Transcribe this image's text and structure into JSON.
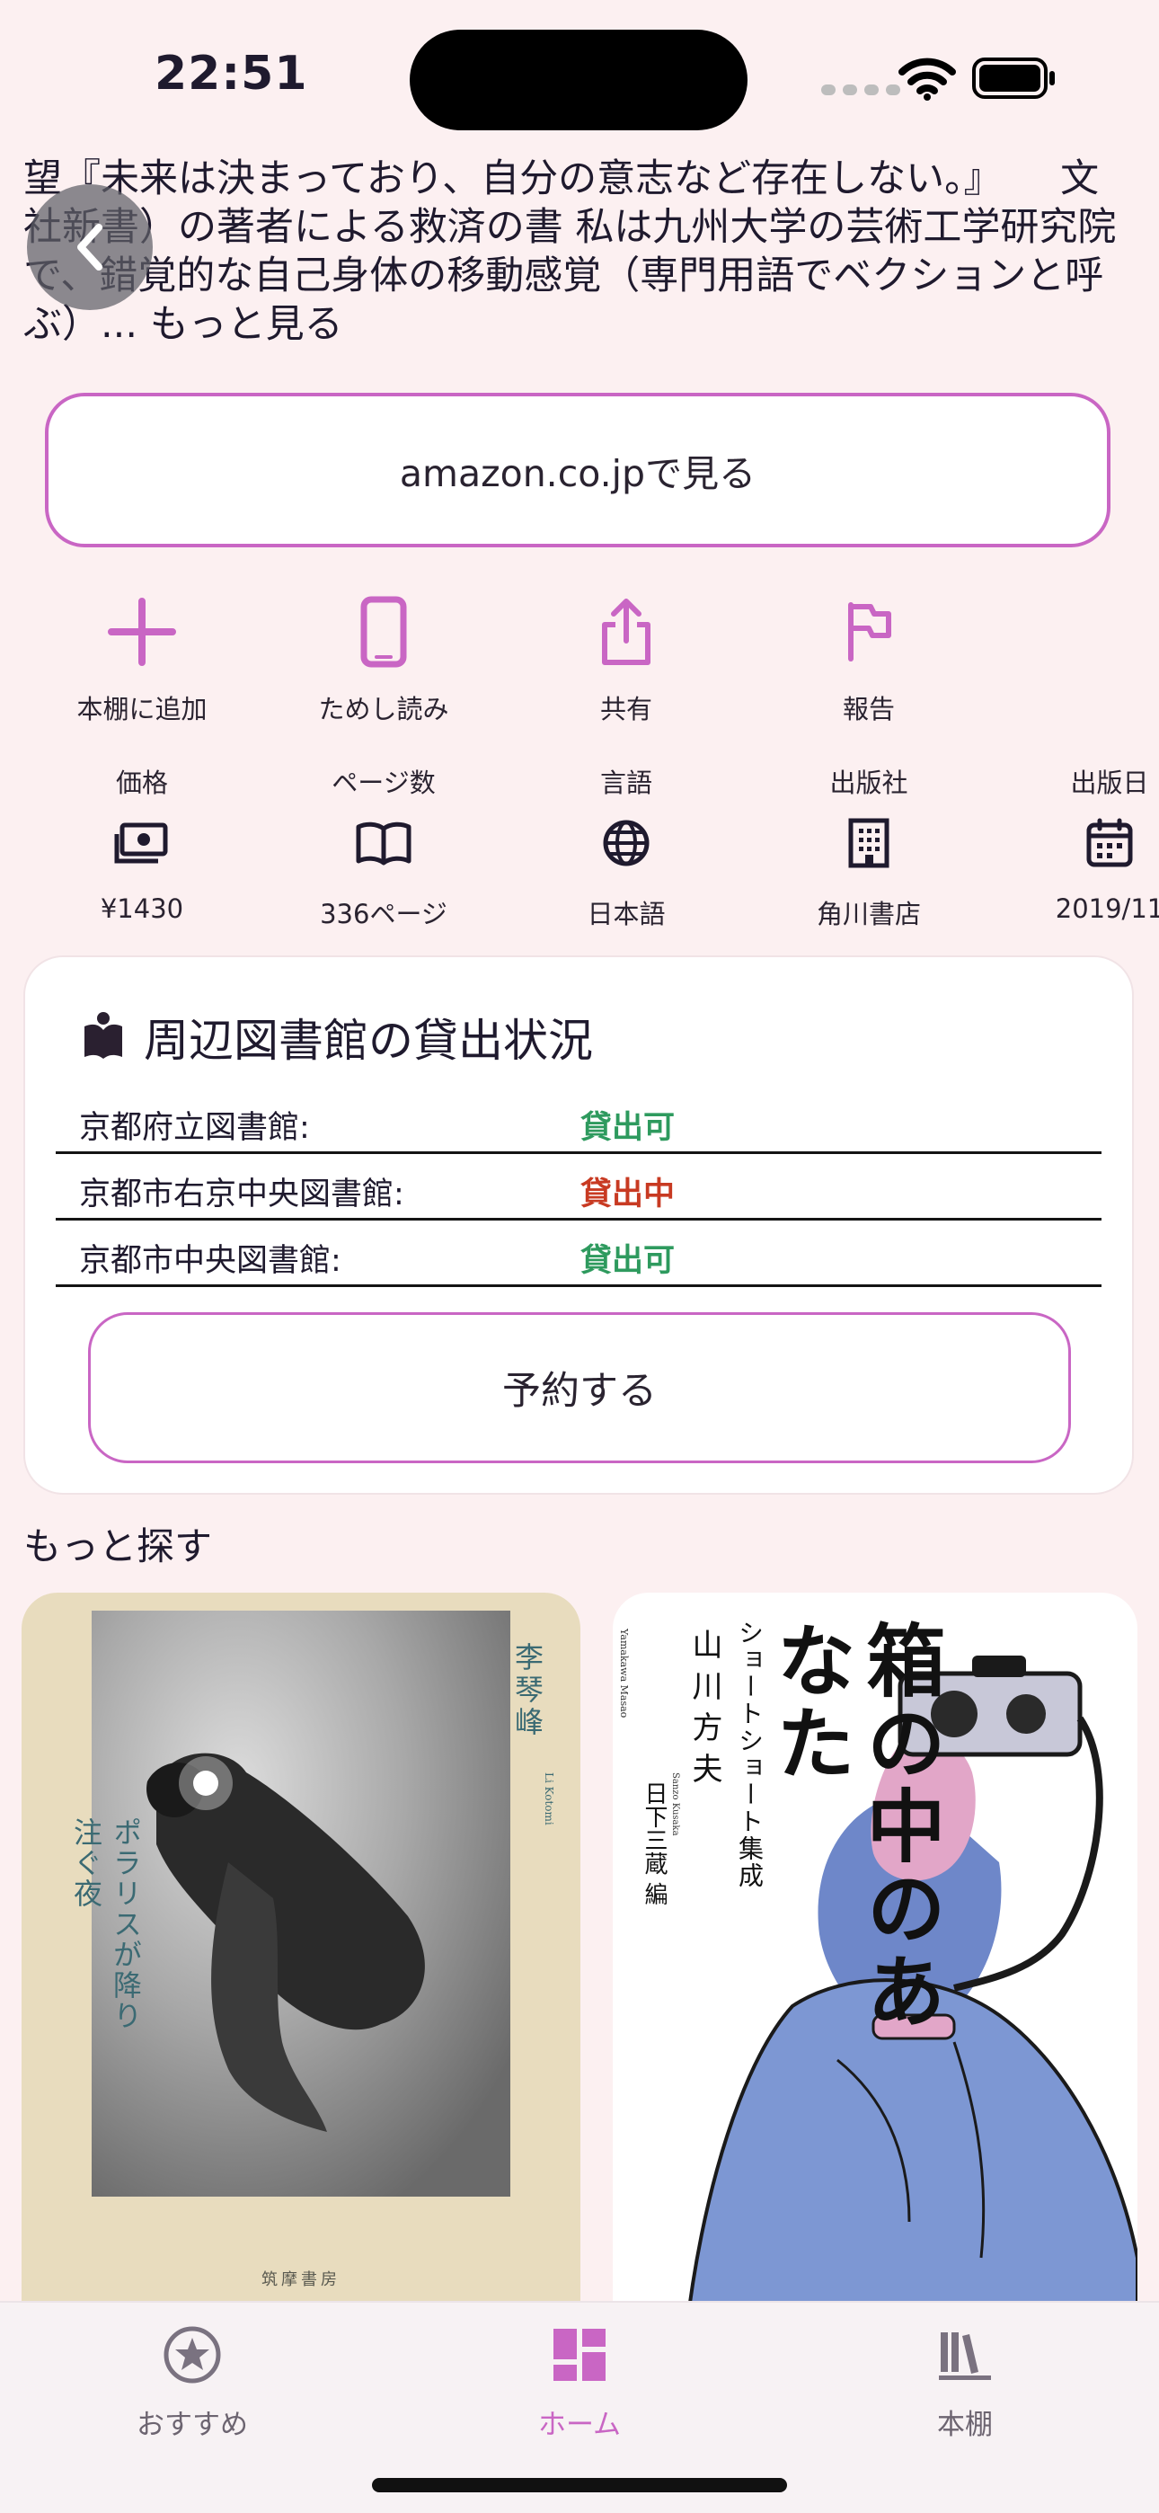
{
  "status_bar": {
    "time": "22:51"
  },
  "description": {
    "text": "望『未来は決まっており、自分の意志など存在しない。』　　文社新書）の著者による救済の書 私は九州大学の芸術工学研究院で、錯覚的な自己身体の移動感覚（専門用語でベクションと呼ぶ）...",
    "more_label": "もっと見る"
  },
  "amazon_button": {
    "label": "amazon.co.jpで見る"
  },
  "actions": [
    {
      "label": "本棚に追加",
      "icon": "plus-icon"
    },
    {
      "label": "ためし読み",
      "icon": "phone-icon"
    },
    {
      "label": "共有",
      "icon": "share-icon"
    },
    {
      "label": "報告",
      "icon": "flag-icon"
    }
  ],
  "info": [
    {
      "header": "価格",
      "value": "¥1430",
      "icon": "money-icon"
    },
    {
      "header": "ページ数",
      "value": "336ページ",
      "icon": "book-open-icon"
    },
    {
      "header": "言語",
      "value": "日本語",
      "icon": "globe-icon"
    },
    {
      "header": "出版社",
      "value": "角川書店",
      "icon": "building-icon"
    },
    {
      "header": "出版日",
      "value": "2019/11",
      "icon": "calendar-icon"
    }
  ],
  "library": {
    "title": "周辺図書館の貸出状況",
    "rows": [
      {
        "name": "京都府立図書館:",
        "status": "貸出可",
        "status_color": "#2e9a5e"
      },
      {
        "name": "京都市右京中央図書館:",
        "status": "貸出中",
        "status_color": "#c83a22"
      },
      {
        "name": "京都市中央図書館:",
        "status": "貸出可",
        "status_color": "#2e9a5e"
      }
    ],
    "reserve_label": "予約する"
  },
  "more_section": {
    "title": "もっと探す"
  },
  "books": [
    {
      "title": "ポラリスが降り注ぐ夜",
      "author": "李琴峰",
      "author_romaji": "Li Kotomi",
      "publisher": "筑摩書房"
    },
    {
      "title": "箱の中のあなた",
      "subtitle": "ショートショート集成",
      "author": "山川方夫",
      "editor": "日下三蔵 編",
      "author_romaji": "Yamakawa Masao",
      "editor_romaji": "Sanzo Kusaka"
    }
  ],
  "tabs": [
    {
      "label": "おすすめ",
      "icon": "star-icon",
      "active": false
    },
    {
      "label": "ホーム",
      "icon": "dashboard-icon",
      "active": true
    },
    {
      "label": "本棚",
      "icon": "bookshelf-icon",
      "active": false
    }
  ],
  "colors": {
    "accent": "#c966c4",
    "background": "#fcf0f1",
    "available": "#2e9a5e",
    "on_loan": "#c83a22"
  }
}
